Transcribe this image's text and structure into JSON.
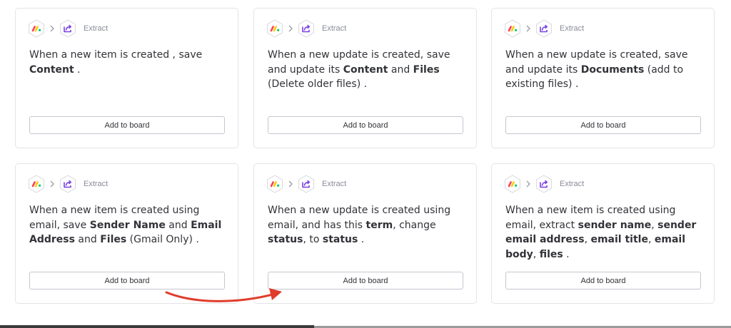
{
  "cards": [
    {
      "step_label": "Extract",
      "description": [
        [
          "When a new item is created , save ",
          false
        ],
        [
          "Content",
          true
        ],
        [
          " .",
          false
        ]
      ],
      "button_label": "Add to board"
    },
    {
      "step_label": "Extract",
      "description": [
        [
          "When a new update is created, save and update its ",
          false
        ],
        [
          "Content",
          true
        ],
        [
          " and ",
          false
        ],
        [
          "Files",
          true
        ],
        [
          " (Delete older files) .",
          false
        ]
      ],
      "button_label": "Add to board"
    },
    {
      "step_label": "Extract",
      "description": [
        [
          "When a new update is created, save and update its ",
          false
        ],
        [
          "Documents",
          true
        ],
        [
          " (add to existing files) .",
          false
        ]
      ],
      "button_label": "Add to board"
    },
    {
      "step_label": "Extract",
      "description": [
        [
          "When a new item is created using email, save ",
          false
        ],
        [
          "Sender Name",
          true
        ],
        [
          " and ",
          false
        ],
        [
          "Email Address",
          true
        ],
        [
          " and ",
          false
        ],
        [
          "Files",
          true
        ],
        [
          " (Gmail Only) .",
          false
        ]
      ],
      "button_label": "Add to board"
    },
    {
      "step_label": "Extract",
      "description": [
        [
          "When a new update is created using email, and has this ",
          false
        ],
        [
          "term",
          true
        ],
        [
          ", change ",
          false
        ],
        [
          "status",
          true
        ],
        [
          ", to ",
          false
        ],
        [
          "status",
          true
        ],
        [
          " .",
          false
        ]
      ],
      "button_label": "Add to board"
    },
    {
      "step_label": "Extract",
      "description": [
        [
          "When a new item is created using email, extract ",
          false
        ],
        [
          "sender name",
          true
        ],
        [
          ", ",
          false
        ],
        [
          "sender email address",
          true
        ],
        [
          ", ",
          false
        ],
        [
          "email title",
          true
        ],
        [
          ", ",
          false
        ],
        [
          "email body",
          true
        ],
        [
          ", ",
          false
        ],
        [
          "files",
          true
        ],
        [
          " .",
          false
        ]
      ],
      "button_label": "Add to board"
    }
  ],
  "icons": {
    "source_app": "monday-logo-icon",
    "separator": "chevron-right-icon",
    "action": "extract-share-icon"
  },
  "colors": {
    "monday_red": "#ff3d57",
    "monday_yellow": "#ffcb00",
    "monday_green": "#00ca72",
    "action_purple": "#7b3fe4",
    "annotation_arrow": "#e03c2a"
  }
}
